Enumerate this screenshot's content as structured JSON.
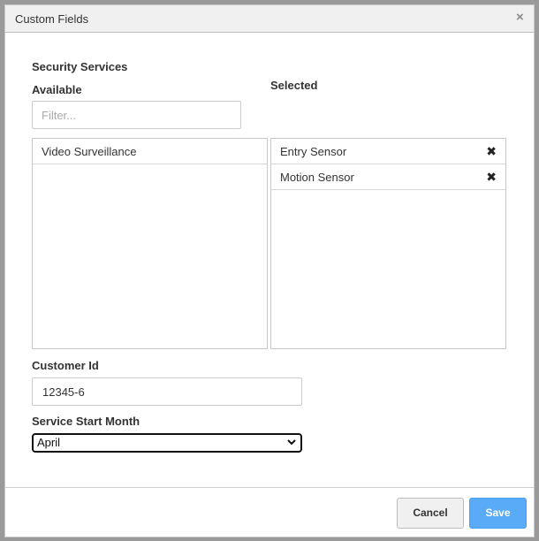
{
  "dialog": {
    "title": "Custom Fields",
    "close_symbol": "×"
  },
  "security_services": {
    "heading": "Security Services",
    "available_label": "Available",
    "selected_label": "Selected",
    "filter_placeholder": "Filter...",
    "available_items": [
      "Video Surveillance"
    ],
    "selected_items": [
      "Entry Sensor",
      "Motion Sensor"
    ],
    "remove_symbol": "✖"
  },
  "customer_id": {
    "label": "Customer Id",
    "value": "12345-6"
  },
  "service_start_month": {
    "label": "Service Start Month",
    "selected": "April"
  },
  "footer": {
    "cancel_label": "Cancel",
    "save_label": "Save"
  },
  "colors": {
    "save_button": "#5aabf7",
    "header_bg": "#f0f0f0",
    "overlay": "#9a9a9a"
  }
}
